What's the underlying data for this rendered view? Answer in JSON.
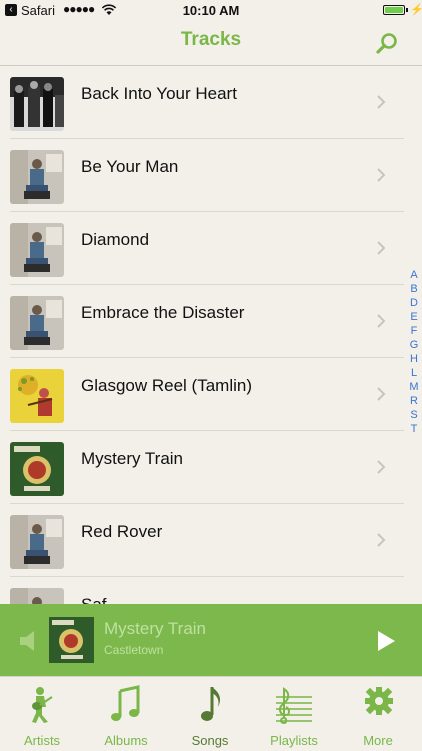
{
  "status_bar": {
    "back_app": "Safari",
    "signal_dots": "●●●●●",
    "time": "10:10 AM",
    "battery_level": 1.0
  },
  "nav": {
    "title": "Tracks",
    "search_icon": "search-icon"
  },
  "tracks": [
    {
      "title": "Back Into Your Heart"
    },
    {
      "title": "Be Your Man"
    },
    {
      "title": "Diamond"
    },
    {
      "title": "Embrace the Disaster"
    },
    {
      "title": "Glasgow Reel (Tamlin)"
    },
    {
      "title": "Mystery Train"
    },
    {
      "title": "Red Rover"
    },
    {
      "title": "Saf..."
    }
  ],
  "index_letters": [
    "A",
    "B",
    "D",
    "E",
    "F",
    "G",
    "H",
    "L",
    "M",
    "R",
    "S",
    "T"
  ],
  "now_playing": {
    "title": "Mystery Train",
    "artist": "Castletown",
    "album_art_text": "Castletown",
    "album_art_subtext": "In Reel Time"
  },
  "tabs": [
    {
      "label": "Artists",
      "icon": "guitarist-icon"
    },
    {
      "label": "Albums",
      "icon": "music-note-icon"
    },
    {
      "label": "Songs",
      "icon": "eighth-note-icon",
      "active": true
    },
    {
      "label": "Playlists",
      "icon": "treble-clef-staff-icon"
    },
    {
      "label": "More",
      "icon": "gear-icon"
    }
  ],
  "colors": {
    "accent": "#7ab648",
    "player_bg": "#7cb84c",
    "index": "#3a74d4",
    "background": "#f3f0ea"
  }
}
